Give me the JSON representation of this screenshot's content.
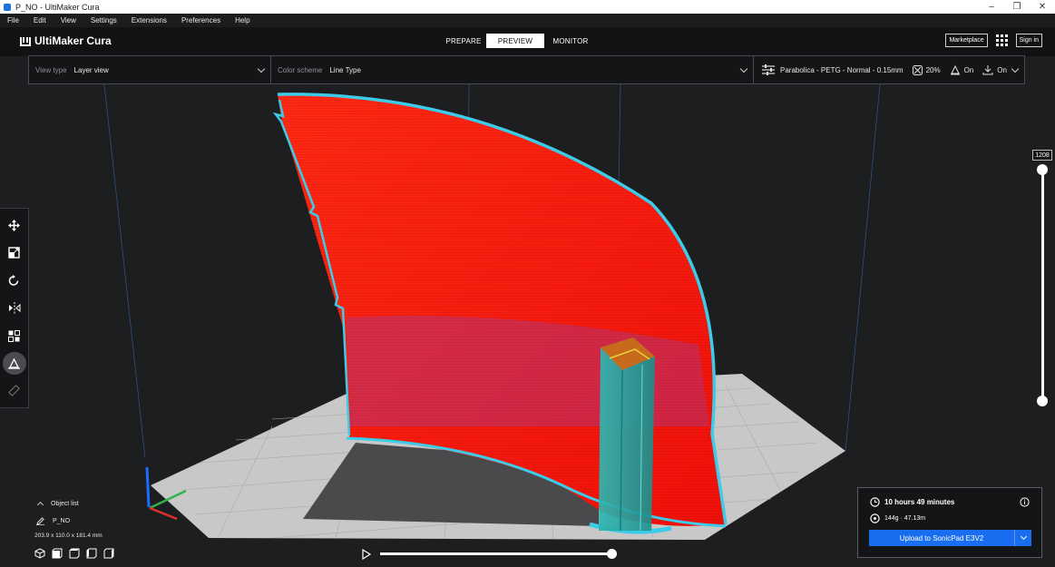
{
  "window": {
    "title": "P_NO - UltiMaker Cura"
  },
  "menu": [
    "File",
    "Edit",
    "View",
    "Settings",
    "Extensions",
    "Preferences",
    "Help"
  ],
  "header": {
    "logo_text": "UltiMaker Cura",
    "tabs": [
      "PREPARE",
      "PREVIEW",
      "MONITOR"
    ],
    "active_tab": "PREVIEW",
    "marketplace_label": "Marketplace",
    "signin_label": "Sign in"
  },
  "topbar": {
    "view_type_label": "View type",
    "view_type_value": "Layer view",
    "color_scheme_label": "Color scheme",
    "color_scheme_value": "Line Type",
    "profile": "Parabolica - PETG - Normal - 0.15mm",
    "infill": "20%",
    "support": "On",
    "adhesion": "On"
  },
  "toolbar": {
    "tools": [
      "move-icon",
      "scale-icon",
      "rotate-icon",
      "mirror-icon",
      "per-model-settings-icon",
      "support-blocker-icon",
      "measure-icon"
    ],
    "active_tool": "support-blocker-icon"
  },
  "layer_slider": {
    "value": "1208",
    "lower_fraction": 0.0,
    "upper_fraction": 1.0
  },
  "object_list": {
    "title": "Object list",
    "object_name": "P_NO",
    "dimensions": "203.9 x 110.0 x 181.4 mm",
    "view_buttons": [
      "3d-view-icon",
      "front-view-icon",
      "top-view-icon",
      "left-view-icon",
      "right-view-icon"
    ]
  },
  "playback": {
    "progress": 1.0
  },
  "print_info": {
    "time": "10 hours 49 minutes",
    "material": "144g · 47.13m",
    "upload_label": "Upload to SonicPad E3V2"
  },
  "colors": {
    "accent": "#196ef0",
    "model_red": "#ff1b0f",
    "wall_cyan": "#35c8e6",
    "support_teal": "#2aa9a5",
    "build_plate": "#c9c9c9"
  }
}
